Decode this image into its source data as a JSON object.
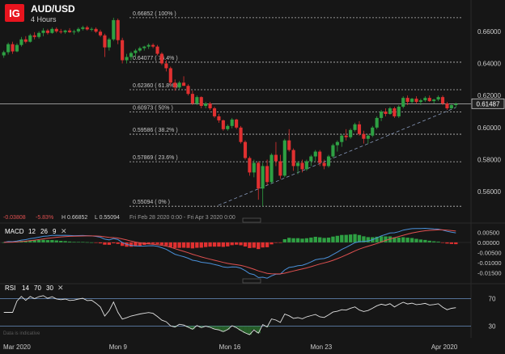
{
  "header": {
    "logo_text": "IG",
    "symbol": "AUD/USD",
    "timeframe": "4 Hours"
  },
  "info_bar": {
    "change": "-0.03808",
    "change_pct": "-5.83%",
    "high": "H 0.66852",
    "low": "L 0.55094",
    "range": "Fri Feb 28 2020 0:00 - Fri Apr 3 2020 0:00"
  },
  "disclaimer": "Data is indicative",
  "colors": {
    "background": "#161616",
    "up_candle": "#2ea043",
    "down_candle": "#e03030",
    "macd_line": "#4a90d9",
    "signal_line": "#e05050",
    "rsi_line": "#e0e0e0",
    "fib_line": "#bbbbbb",
    "logo_bg": "#e8141e"
  },
  "chart_data": [
    {
      "type": "candlestick",
      "panel": "price",
      "x_tick_labels": [
        "Mar 2020",
        "Mon 9",
        "Mon 16",
        "Mon 23",
        "Apr 2020"
      ],
      "y_tick_labels": [
        "0.66000",
        "0.64000",
        "0.62000",
        "0.60000",
        "0.58000",
        "0.56000"
      ],
      "ylim": [
        0.5475,
        0.6735
      ],
      "current_price": "0.61487",
      "fibonacci_levels": [
        {
          "label": "0.66852 ( 100% )",
          "value": 0.66852
        },
        {
          "label": "0.64077 ( 76.4% )",
          "value": 0.64077
        },
        {
          "label": "0.62360 ( 61.8% )",
          "value": 0.6236
        },
        {
          "label": "0.60973 ( 50% )",
          "value": 0.60973
        },
        {
          "label": "0.59586 ( 38.2% )",
          "value": 0.59586
        },
        {
          "label": "0.57869 ( 23.6% )",
          "value": 0.57869
        },
        {
          "label": "0.55094 ( 0% )",
          "value": 0.55094
        }
      ],
      "trendline": {
        "from": 0.5515,
        "to": 0.6125,
        "style": "dashed"
      },
      "ohlc": [
        [
          0.645,
          0.648,
          0.6435,
          0.647
        ],
        [
          0.647,
          0.653,
          0.6455,
          0.652
        ],
        [
          0.652,
          0.6535,
          0.646,
          0.6475
        ],
        [
          0.6475,
          0.6525,
          0.647,
          0.6515
        ],
        [
          0.6515,
          0.6565,
          0.6505,
          0.655
        ],
        [
          0.655,
          0.657,
          0.6525,
          0.6535
        ],
        [
          0.6535,
          0.6585,
          0.653,
          0.6575
        ],
        [
          0.6575,
          0.6595,
          0.655,
          0.6565
        ],
        [
          0.6565,
          0.66,
          0.6555,
          0.659
        ],
        [
          0.659,
          0.662,
          0.657,
          0.6605
        ],
        [
          0.6605,
          0.6615,
          0.658,
          0.659
        ],
        [
          0.659,
          0.6625,
          0.6585,
          0.6615
        ],
        [
          0.6615,
          0.6625,
          0.659,
          0.66
        ],
        [
          0.66,
          0.6615,
          0.6585,
          0.6595
        ],
        [
          0.6595,
          0.661,
          0.6585,
          0.6605
        ],
        [
          0.6605,
          0.662,
          0.659,
          0.6595
        ],
        [
          0.6595,
          0.661,
          0.658,
          0.66
        ],
        [
          0.66,
          0.6625,
          0.659,
          0.6615
        ],
        [
          0.6615,
          0.6635,
          0.6605,
          0.6625
        ],
        [
          0.6625,
          0.6635,
          0.6605,
          0.6612
        ],
        [
          0.6612,
          0.6625,
          0.66,
          0.6615
        ],
        [
          0.6615,
          0.6625,
          0.659,
          0.6598
        ],
        [
          0.6598,
          0.661,
          0.6565,
          0.6575
        ],
        [
          0.6575,
          0.6585,
          0.644,
          0.65
        ],
        [
          0.65,
          0.656,
          0.648,
          0.655
        ],
        [
          0.655,
          0.6685,
          0.654,
          0.667
        ],
        [
          0.667,
          0.668,
          0.652,
          0.6545
        ],
        [
          0.6545,
          0.656,
          0.64,
          0.642
        ],
        [
          0.642,
          0.646,
          0.64,
          0.644
        ],
        [
          0.644,
          0.6475,
          0.642,
          0.6465
        ],
        [
          0.6465,
          0.649,
          0.644,
          0.648
        ],
        [
          0.648,
          0.6505,
          0.647,
          0.6495
        ],
        [
          0.6495,
          0.651,
          0.648,
          0.6505
        ],
        [
          0.6505,
          0.6525,
          0.649,
          0.6515
        ],
        [
          0.6515,
          0.6525,
          0.6495,
          0.6505
        ],
        [
          0.6505,
          0.6515,
          0.645,
          0.646
        ],
        [
          0.646,
          0.647,
          0.639,
          0.64
        ],
        [
          0.64,
          0.642,
          0.635,
          0.637
        ],
        [
          0.637,
          0.638,
          0.626,
          0.628
        ],
        [
          0.628,
          0.63,
          0.623,
          0.625
        ],
        [
          0.625,
          0.629,
          0.624,
          0.628
        ],
        [
          0.628,
          0.632,
          0.627,
          0.626
        ],
        [
          0.626,
          0.627,
          0.62,
          0.621
        ],
        [
          0.621,
          0.623,
          0.614,
          0.615
        ],
        [
          0.615,
          0.62,
          0.614,
          0.619
        ],
        [
          0.619,
          0.6195,
          0.612,
          0.6135
        ],
        [
          0.6135,
          0.616,
          0.612,
          0.615
        ],
        [
          0.615,
          0.616,
          0.611,
          0.612
        ],
        [
          0.612,
          0.613,
          0.606,
          0.607
        ],
        [
          0.607,
          0.6085,
          0.603,
          0.6045
        ],
        [
          0.6045,
          0.605,
          0.598,
          0.599
        ],
        [
          0.599,
          0.602,
          0.598,
          0.601
        ],
        [
          0.601,
          0.606,
          0.5995,
          0.605
        ],
        [
          0.605,
          0.6055,
          0.599,
          0.6
        ],
        [
          0.6,
          0.601,
          0.59,
          0.591
        ],
        [
          0.591,
          0.592,
          0.58,
          0.581
        ],
        [
          0.581,
          0.582,
          0.57,
          0.572
        ],
        [
          0.572,
          0.58,
          0.569,
          0.578
        ],
        [
          0.578,
          0.579,
          0.555,
          0.562
        ],
        [
          0.562,
          0.578,
          0.5509,
          0.576
        ],
        [
          0.576,
          0.58,
          0.564,
          0.566
        ],
        [
          0.566,
          0.584,
          0.565,
          0.583
        ],
        [
          0.583,
          0.591,
          0.576,
          0.579
        ],
        [
          0.579,
          0.583,
          0.568,
          0.57
        ],
        [
          0.57,
          0.593,
          0.569,
          0.592
        ],
        [
          0.592,
          0.599,
          0.585,
          0.586
        ],
        [
          0.586,
          0.587,
          0.573,
          0.576
        ],
        [
          0.576,
          0.579,
          0.571,
          0.578
        ],
        [
          0.578,
          0.58,
          0.572,
          0.574
        ],
        [
          0.574,
          0.58,
          0.573,
          0.579
        ],
        [
          0.579,
          0.583,
          0.576,
          0.582
        ],
        [
          0.582,
          0.586,
          0.579,
          0.585
        ],
        [
          0.585,
          0.586,
          0.576,
          0.578
        ],
        [
          0.578,
          0.58,
          0.574,
          0.576
        ],
        [
          0.576,
          0.583,
          0.575,
          0.582
        ],
        [
          0.582,
          0.59,
          0.581,
          0.589
        ],
        [
          0.589,
          0.592,
          0.585,
          0.591
        ],
        [
          0.591,
          0.596,
          0.588,
          0.595
        ],
        [
          0.595,
          0.599,
          0.592,
          0.594
        ],
        [
          0.594,
          0.5995,
          0.593,
          0.5985
        ],
        [
          0.5985,
          0.603,
          0.5975,
          0.602
        ],
        [
          0.602,
          0.604,
          0.595,
          0.596
        ],
        [
          0.596,
          0.598,
          0.59,
          0.593
        ],
        [
          0.593,
          0.596,
          0.59,
          0.595
        ],
        [
          0.595,
          0.601,
          0.594,
          0.6
        ],
        [
          0.6,
          0.607,
          0.599,
          0.606
        ],
        [
          0.606,
          0.611,
          0.604,
          0.61
        ],
        [
          0.61,
          0.612,
          0.607,
          0.6085
        ],
        [
          0.6085,
          0.613,
          0.608,
          0.612
        ],
        [
          0.612,
          0.613,
          0.606,
          0.607
        ],
        [
          0.607,
          0.614,
          0.606,
          0.613
        ],
        [
          0.613,
          0.6195,
          0.612,
          0.6185
        ],
        [
          0.6185,
          0.62,
          0.614,
          0.616
        ],
        [
          0.616,
          0.6185,
          0.615,
          0.618
        ],
        [
          0.618,
          0.6195,
          0.615,
          0.616
        ],
        [
          0.616,
          0.618,
          0.614,
          0.617
        ],
        [
          0.617,
          0.6195,
          0.616,
          0.6185
        ],
        [
          0.6185,
          0.62,
          0.616,
          0.6165
        ],
        [
          0.6165,
          0.618,
          0.615,
          0.6175
        ],
        [
          0.6175,
          0.62,
          0.6165,
          0.619
        ],
        [
          0.619,
          0.62,
          0.614,
          0.615
        ],
        [
          0.615,
          0.616,
          0.611,
          0.612
        ],
        [
          0.612,
          0.6145,
          0.6115,
          0.614
        ],
        [
          0.614,
          0.6155,
          0.6125,
          0.6149
        ]
      ]
    },
    {
      "type": "line",
      "panel": "macd",
      "title": "MACD",
      "params": [
        "12",
        "26",
        "9"
      ],
      "y_tick_labels": [
        "0.00500",
        "0.00000",
        "-0.00500",
        "-0.01000",
        "-0.01500"
      ],
      "ylim": [
        -0.0175,
        0.0075
      ]
    },
    {
      "type": "line",
      "panel": "rsi",
      "title": "RSI",
      "params": [
        "14",
        "70",
        "30"
      ],
      "y_tick_labels": [
        "70",
        "30"
      ],
      "ylim": [
        15,
        85
      ]
    }
  ]
}
